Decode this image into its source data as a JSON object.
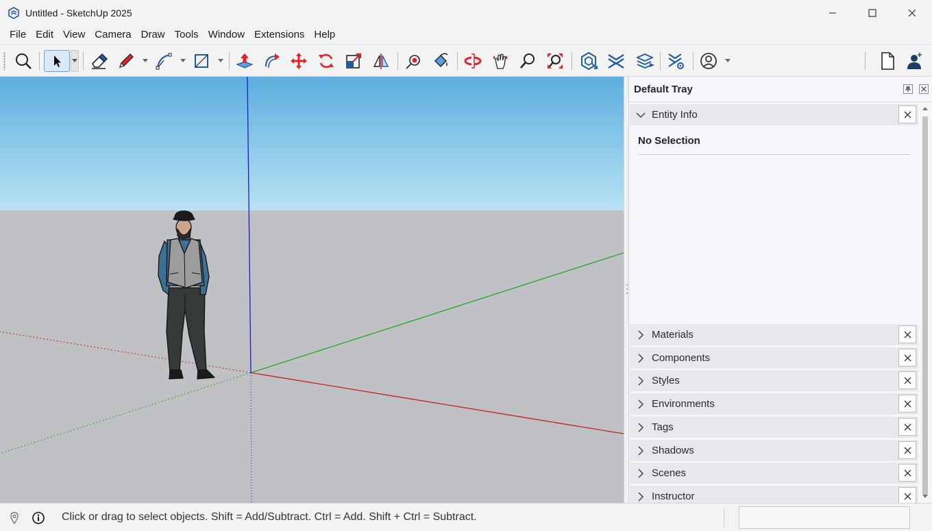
{
  "window": {
    "title": "Untitled - SketchUp 2025"
  },
  "menu": {
    "items": [
      "File",
      "Edit",
      "View",
      "Camera",
      "Draw",
      "Tools",
      "Window",
      "Extensions",
      "Help"
    ]
  },
  "toolbar": {
    "tools": [
      "zoom-extents",
      "select",
      "eraser",
      "pencil-line",
      "arc",
      "rectangle",
      "push-pull",
      "follow-me",
      "move",
      "rotate",
      "scale",
      "flip",
      "paint-bucket",
      "tape-measure",
      "orbit",
      "pan",
      "zoom",
      "zoom-window",
      "extension-warehouse",
      "3d-warehouse",
      "layout-send",
      "extension-manager",
      "account",
      "new-file",
      "profile"
    ],
    "selected_tool": "select",
    "colors": {
      "tool_red": "#e0242b",
      "tool_blue": "#1f5aa6"
    }
  },
  "viewport": {
    "colors": {
      "sky_top": "#5caedf",
      "sky_bottom": "#b8e2f3",
      "ground": "#c0c1c4",
      "axis_red": "#c41e1e",
      "axis_green": "#1fa81f",
      "axis_blue": "#1a1ad0"
    },
    "scale_figure": "person"
  },
  "tray": {
    "title": "Default Tray",
    "entity_info": {
      "label": "Entity Info",
      "selection_text": "No Selection"
    },
    "panels": [
      {
        "label": "Materials"
      },
      {
        "label": "Components"
      },
      {
        "label": "Styles"
      },
      {
        "label": "Environments"
      },
      {
        "label": "Tags"
      },
      {
        "label": "Shadows"
      },
      {
        "label": "Scenes"
      },
      {
        "label": "Instructor"
      }
    ]
  },
  "statusbar": {
    "text": "Click or drag to select objects. Shift = Add/Subtract. Ctrl = Add. Shift + Ctrl = Subtract.",
    "measurements_value": ""
  }
}
